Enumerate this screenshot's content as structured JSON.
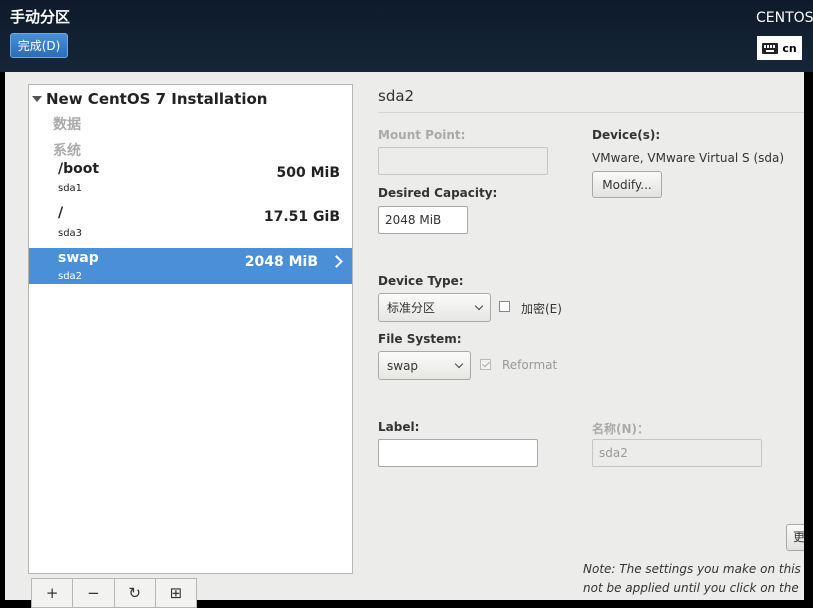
{
  "header": {
    "title": "手动分区",
    "done_button": "完成(D)",
    "brand": "CENTOS",
    "keyboard_layout": "cn"
  },
  "tree": {
    "root": "New CentOS 7 Installation",
    "groups": [
      "数据",
      "系统"
    ],
    "partitions": [
      {
        "mount": "/boot",
        "device": "sda1",
        "size": "500 MiB"
      },
      {
        "mount": "/",
        "device": "sda3",
        "size": "17.51 GiB"
      },
      {
        "mount": "swap",
        "device": "sda2",
        "size": "2048 MiB",
        "selected": true
      }
    ],
    "toolbar": [
      "+",
      "−",
      "↻",
      "⊞"
    ]
  },
  "details": {
    "title": "sda2",
    "mount_point_label": "Mount Point:",
    "mount_point_value": "",
    "desired_capacity_label": "Desired Capacity:",
    "desired_capacity_value": "2048 MiB",
    "devices_label": "Device(s):",
    "devices_value": "VMware, VMware Virtual S (sda)",
    "modify_button": "Modify...",
    "device_type_label": "Device Type:",
    "device_type_value": "标准分区",
    "encrypt_label": "加密(E)",
    "encrypt_checked": false,
    "file_system_label": "File System:",
    "file_system_value": "swap",
    "reformat_label": "Reformat",
    "reformat_checked": true,
    "label_label": "Label:",
    "label_value": "",
    "name_label": "名称(N)：",
    "name_value": "sda2",
    "update_button": "更",
    "note_line1": "Note:  The settings you make on this",
    "note_line2": "not be applied until you click on the"
  },
  "colors": {
    "selection": "#4a90d9",
    "header_bg": "#162638",
    "content_bg": "#ececea"
  }
}
